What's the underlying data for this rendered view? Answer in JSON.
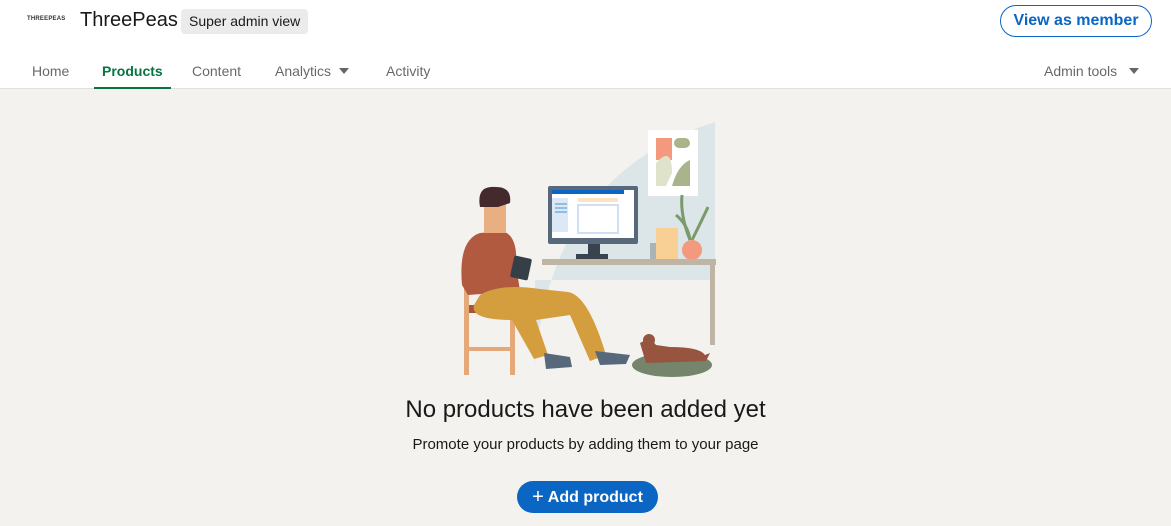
{
  "header": {
    "logo_text": "THREEPEAS",
    "org_name": "ThreePeas",
    "admin_badge": "Super admin view",
    "view_as_member": "View as member"
  },
  "nav": {
    "tabs": [
      {
        "label": "Home",
        "active": false
      },
      {
        "label": "Products",
        "active": true
      },
      {
        "label": "Content",
        "active": false
      },
      {
        "label": "Analytics",
        "active": false,
        "dropdown": true
      },
      {
        "label": "Activity",
        "active": false
      }
    ],
    "admin_tools": "Admin tools"
  },
  "empty_state": {
    "title": "No products have been added yet",
    "subtitle": "Promote your products by adding them to your page",
    "button_icon": "+",
    "button_label": "Add product"
  },
  "colors": {
    "accent": "#0a66c2",
    "active_tab": "#057642",
    "background": "#f3f2ef"
  }
}
